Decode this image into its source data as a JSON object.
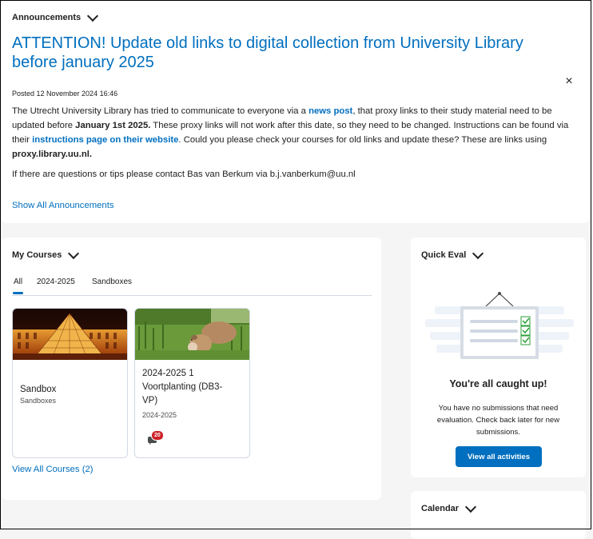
{
  "announcements": {
    "header": "Announcements",
    "title": "ATTENTION! Update old links to digital collection from University Library before january 2025",
    "close_glyph": "×",
    "posted": "Posted 12 November 2024 16:46",
    "body": {
      "t1": "The Utrecht University Library has tried to communicate to everyone via a ",
      "link1": "news post",
      "t2": ", that proxy links to their study material need to be updated before ",
      "bold1": "January 1st 2025.",
      "t3": " These proxy links will not work after this date, so they need to be changed. Instructions can be found via their ",
      "link2": "instructions page on their website",
      "t4": ". Could you please check your courses for old links and update these? These are links using ",
      "bold2": "proxy.library.uu.nl."
    },
    "contact": "If there are questions or tips please contact Bas van Berkum via b.j.vanberkum@uu.nl",
    "show_all": "Show All Announcements"
  },
  "my_courses": {
    "header": "My Courses",
    "tabs": [
      {
        "label": "All",
        "active": true
      },
      {
        "label": "2024-2025",
        "active": false
      },
      {
        "label": "Sandboxes",
        "active": false
      }
    ],
    "cards": [
      {
        "image": "louvre-pyramid-night-photo",
        "title": "Sandbox",
        "subtitle": "Sandboxes"
      },
      {
        "image": "cow-in-grass-photo",
        "title_lines": [
          "2024-2025 1",
          "Voortplanting (DB3-",
          "VP)"
        ],
        "subtitle": "2024-2025",
        "badge_count": "20",
        "badge_icon": "chat-bubble-icon"
      }
    ],
    "view_all": "View All Courses (2)"
  },
  "quick_eval": {
    "header": "Quick Eval",
    "illustration": "clipboard-checklist-illustration",
    "title": "You're all caught up!",
    "text": "You have no submissions that need evaluation. Check back later for new submissions.",
    "button": "View all activities"
  },
  "calendar": {
    "header": "Calendar"
  },
  "colors": {
    "accent": "#006fbf",
    "badge": "#cd2026",
    "background": "#f5f5f6",
    "check": "#2e9f3a"
  }
}
